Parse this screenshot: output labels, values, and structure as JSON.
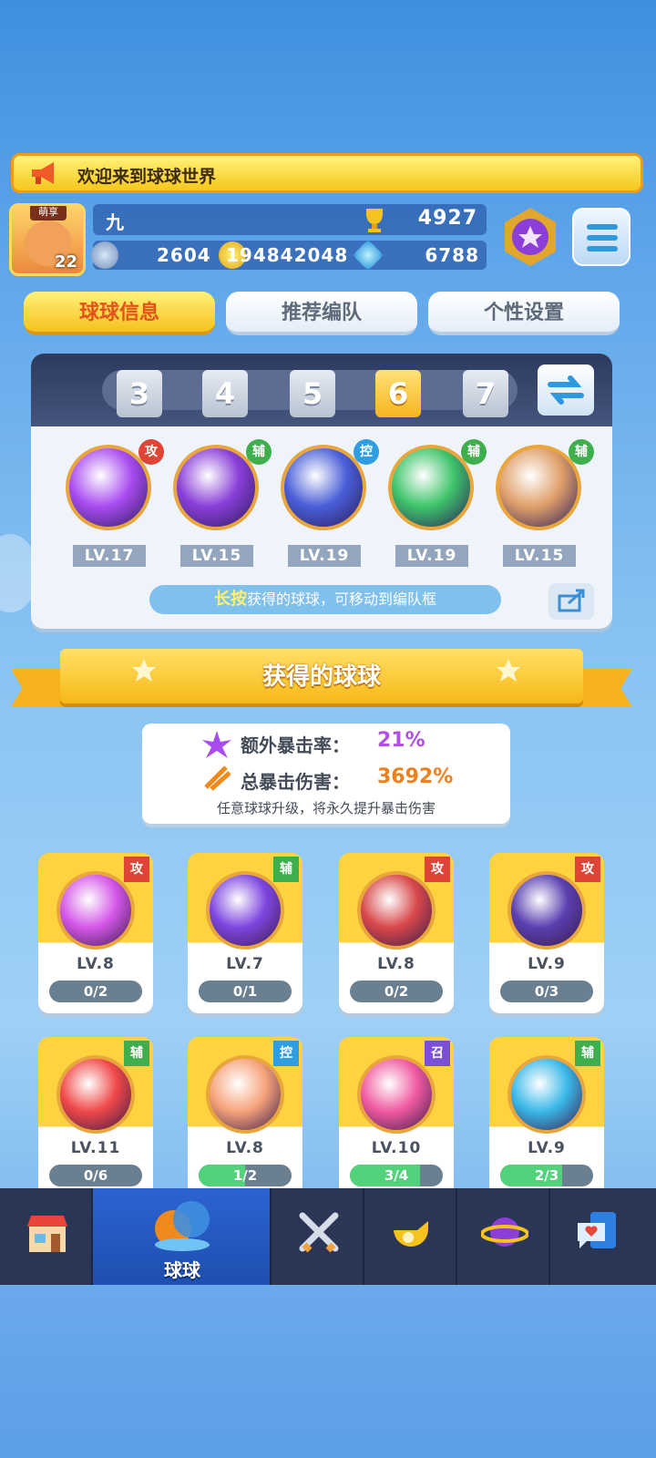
{
  "welcome": "欢迎来到球球世界",
  "player": {
    "badge": "萌享",
    "level": "22",
    "name": "九",
    "trophies": "4927",
    "energy": "2604",
    "coins": "194842048",
    "gems": "6788"
  },
  "tabs": [
    {
      "label": "球球信息",
      "active": true
    },
    {
      "label": "推荐编队",
      "active": false
    },
    {
      "label": "个性设置",
      "active": false
    }
  ],
  "team": {
    "slots": [
      "3",
      "4",
      "5",
      "6",
      "7"
    ],
    "active_slot": "6",
    "balls": [
      {
        "tag": "攻",
        "level": "LV.17",
        "color": "#a84cf0",
        "tag_color": "#e04436"
      },
      {
        "tag": "辅",
        "level": "LV.15",
        "color": "#8a3fd8",
        "tag_color": "#3fae4c"
      },
      {
        "tag": "控",
        "level": "LV.19",
        "color": "#4a5fd8",
        "tag_color": "#2f9ee0"
      },
      {
        "tag": "辅",
        "level": "LV.19",
        "color": "#3ec46a",
        "tag_color": "#3fae4c"
      },
      {
        "tag": "辅",
        "level": "LV.15",
        "color": "#e0a06a",
        "tag_color": "#3fae4c"
      }
    ],
    "hint_highlight": "长按",
    "hint_text": "获得的球球，可移动到编队框"
  },
  "section_title": "获得的球球",
  "crit": {
    "extra_rate_label": "额外暴击率：",
    "extra_rate_value": "21%",
    "total_damage_label": "总暴击伤害：",
    "total_damage_value": "3692%",
    "note": "任意球球升级，将永久提升暴击伤害"
  },
  "owned": [
    {
      "tag": "攻",
      "level": "LV.8",
      "progress": "0/2",
      "fill": 0.0,
      "color": "#d457e8",
      "tag_color": "#e04436"
    },
    {
      "tag": "辅",
      "level": "LV.7",
      "progress": "0/1",
      "fill": 0.0,
      "color": "#7d46e0",
      "tag_color": "#3fae4c"
    },
    {
      "tag": "攻",
      "level": "LV.8",
      "progress": "0/2",
      "fill": 0.0,
      "color": "#d8484a",
      "tag_color": "#e04436"
    },
    {
      "tag": "攻",
      "level": "LV.9",
      "progress": "0/3",
      "fill": 0.0,
      "color": "#5a3fb0",
      "tag_color": "#e04436"
    },
    {
      "tag": "辅",
      "level": "LV.11",
      "progress": "0/6",
      "fill": 0.0,
      "color": "#f04848",
      "tag_color": "#3fae4c"
    },
    {
      "tag": "控",
      "level": "LV.8",
      "progress": "1/2",
      "fill": 0.5,
      "color": "#f6a37a",
      "tag_color": "#2f9ee0"
    },
    {
      "tag": "召",
      "level": "LV.10",
      "progress": "3/4",
      "fill": 0.75,
      "color": "#f05aa0",
      "tag_color": "#7a50d8"
    },
    {
      "tag": "辅",
      "level": "LV.9",
      "progress": "2/3",
      "fill": 0.667,
      "color": "#3ab8e8",
      "tag_color": "#3fae4c"
    }
  ],
  "nav": [
    {
      "icon": "shop-icon",
      "label": "",
      "active": false
    },
    {
      "icon": "balls-icon",
      "label": "球球",
      "active": true
    },
    {
      "icon": "battle-swords-icon",
      "label": "",
      "active": false
    },
    {
      "icon": "whistle-icon",
      "label": "",
      "active": false
    },
    {
      "icon": "planet-icon",
      "label": "",
      "active": false
    },
    {
      "icon": "chat-heart-icon",
      "label": "",
      "active": false
    }
  ]
}
